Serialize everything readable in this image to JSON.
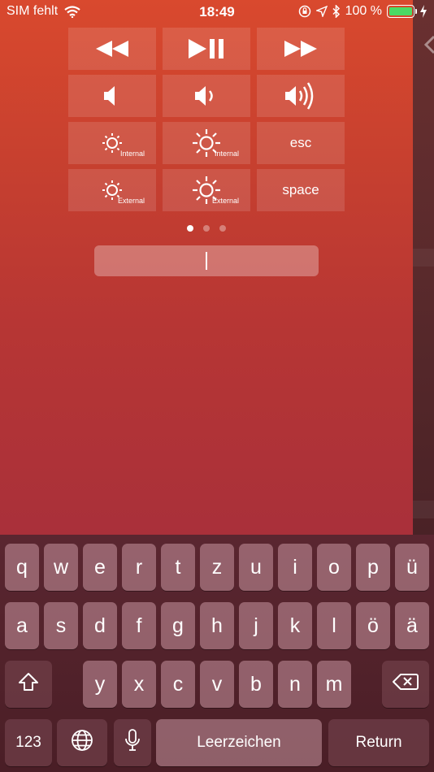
{
  "status_bar": {
    "carrier": "SIM fehlt",
    "time": "18:49",
    "battery": "100 %"
  },
  "controls": [
    {
      "name": "rewind-button",
      "icon": "rewind-icon",
      "label": "",
      "sub": ""
    },
    {
      "name": "play-pause-button",
      "icon": "play-pause-icon",
      "label": "",
      "sub": ""
    },
    {
      "name": "fast-forward-button",
      "icon": "fast-forward-icon",
      "label": "",
      "sub": ""
    },
    {
      "name": "mute-button",
      "icon": "speaker-mute-icon",
      "label": "",
      "sub": ""
    },
    {
      "name": "volume-down-button",
      "icon": "speaker-low-icon",
      "label": "",
      "sub": ""
    },
    {
      "name": "volume-up-button",
      "icon": "speaker-high-icon",
      "label": "",
      "sub": ""
    },
    {
      "name": "internal-brightness-down-button",
      "icon": "brightness-low-icon",
      "label": "",
      "sub": "Internal"
    },
    {
      "name": "internal-brightness-up-button",
      "icon": "brightness-high-icon",
      "label": "",
      "sub": "Internal"
    },
    {
      "name": "esc-button",
      "icon": "",
      "label": "esc",
      "sub": ""
    },
    {
      "name": "external-brightness-down-button",
      "icon": "brightness-low-icon",
      "label": "",
      "sub": "External"
    },
    {
      "name": "external-brightness-up-button",
      "icon": "brightness-high-icon",
      "label": "",
      "sub": "External"
    },
    {
      "name": "space-button",
      "icon": "",
      "label": "space",
      "sub": ""
    }
  ],
  "pager": {
    "count": 3,
    "active": 0
  },
  "text_input": {
    "value": "",
    "placeholder": ""
  },
  "keyboard": {
    "row1": [
      "q",
      "w",
      "e",
      "r",
      "t",
      "z",
      "u",
      "i",
      "o",
      "p",
      "ü"
    ],
    "row2": [
      "a",
      "s",
      "d",
      "f",
      "g",
      "h",
      "j",
      "k",
      "l",
      "ö",
      "ä"
    ],
    "row3": [
      "y",
      "x",
      "c",
      "v",
      "b",
      "n",
      "m"
    ],
    "numbers_label": "123",
    "space_label": "Leerzeichen",
    "return_label": "Return"
  }
}
